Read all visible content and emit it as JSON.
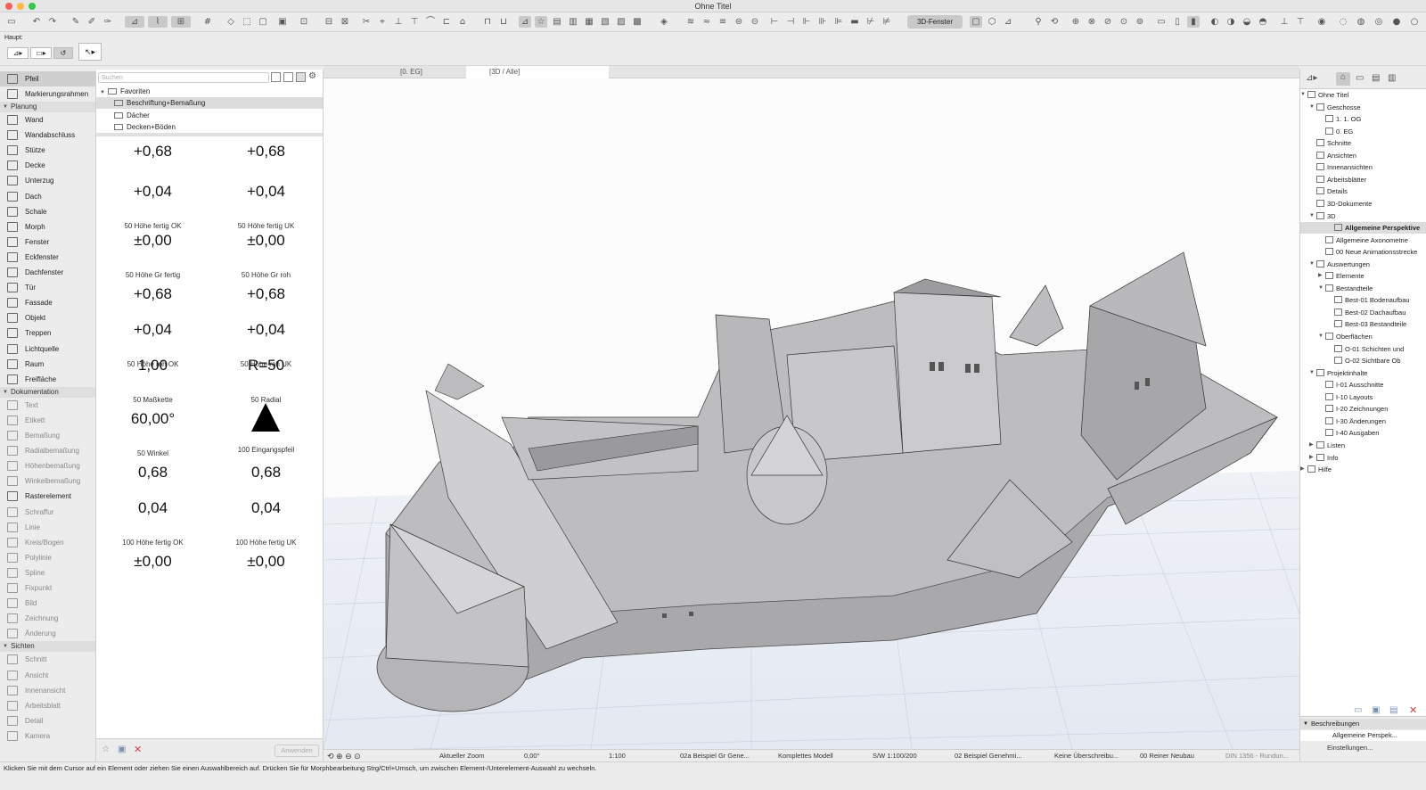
{
  "window": {
    "title": "Ohne Titel"
  },
  "toolbar": {
    "window_3d_label": "3D-Fenster"
  },
  "infobox": {
    "label": "Haupt:"
  },
  "toolbox": {
    "items": [
      {
        "label": "Pfeil",
        "active": true
      },
      {
        "label": "Markierungsrahmen"
      }
    ],
    "planung_label": "Planung",
    "planung": [
      "Wand",
      "Wandabschluss",
      "Stütze",
      "Decke",
      "Unterzug",
      "Dach",
      "Schale",
      "Morph",
      "Fenster",
      "Eckfenster",
      "Dachfenster",
      "Tür",
      "Fassade",
      "Objekt",
      "Treppen",
      "Lichtquelle",
      "Raum",
      "Freifläche"
    ],
    "doku_label": "Dokumentation",
    "doku": [
      "Text",
      "Etikett",
      "Bemaßung",
      "Radialbemaßung",
      "Höhenbemaßung",
      "Winkelbemaßung",
      "Rasterelement",
      "Schraffur",
      "Linie",
      "Kreis/Bogen",
      "Polylinie",
      "Spline",
      "Fixpunkt",
      "Bild",
      "Zeichnung",
      "Änderung"
    ],
    "sichten_label": "Sichten",
    "sichten": [
      "Schnitt",
      "Ansicht",
      "Innenansicht",
      "Arbeitsblatt",
      "Detail",
      "Kamera"
    ]
  },
  "favorites": {
    "search_placeholder": "Suchen",
    "root": "Favoriten",
    "folders": [
      "Beschriftung+Bemaßung",
      "Dächer",
      "Decken+Böden"
    ],
    "cells": [
      {
        "big": "+0,68",
        "cap": ""
      },
      {
        "big": "+0,68",
        "cap": ""
      },
      {
        "big": "+0,04",
        "cap": "50 Höhe fertig OK"
      },
      {
        "big": "+0,04",
        "cap": "50 Höhe fertig UK"
      },
      {
        "big": "±0,00",
        "cap": "50 Höhe Gr fertig"
      },
      {
        "big": "±0,00",
        "cap": "50 Höhe Gr roh"
      },
      {
        "big": "+0,68",
        "cap": ""
      },
      {
        "big": "+0,68",
        "cap": ""
      },
      {
        "big": "+0,04",
        "cap": "50 Höhe roh OK"
      },
      {
        "big": "+0,04",
        "cap": "50 Höhe roh UK"
      },
      {
        "big": "1,00",
        "cap": "50 Maßkette"
      },
      {
        "big": "R=50",
        "cap": "50 Radial"
      },
      {
        "big": "60,00°",
        "cap": "50 Winkel"
      },
      {
        "big": "",
        "cap": "100 Eingangspfeil"
      },
      {
        "big": "0,68",
        "cap": ""
      },
      {
        "big": "0,68",
        "cap": ""
      },
      {
        "big": "0,04",
        "cap": "100 Höhe fertig OK"
      },
      {
        "big": "0,04",
        "cap": "100 Höhe fertig UK"
      },
      {
        "big": "±0,00",
        "cap": ""
      },
      {
        "big": "±0,00",
        "cap": ""
      }
    ],
    "apply_label": "Anwenden"
  },
  "tabs": [
    {
      "label": "[0. EG]"
    },
    {
      "label": "[3D / Alle]",
      "active": true
    }
  ],
  "navigator": {
    "items": [
      {
        "label": "Ohne Titel",
        "level": 0,
        "tri": "▼"
      },
      {
        "label": "Geschosse",
        "level": 1,
        "tri": "▼"
      },
      {
        "label": "1. 1. OG",
        "level": 2
      },
      {
        "label": "0. EG",
        "level": 2
      },
      {
        "label": "Schnitte",
        "level": 1
      },
      {
        "label": "Ansichten",
        "level": 1
      },
      {
        "label": "Innenansichten",
        "level": 1
      },
      {
        "label": "Arbeitsblätter",
        "level": 1
      },
      {
        "label": "Details",
        "level": 1
      },
      {
        "label": "3D-Dokumente",
        "level": 1
      },
      {
        "label": "3D",
        "level": 1,
        "tri": "▼"
      },
      {
        "label": "Allgemeine Perspektive",
        "level": 2,
        "selected": true
      },
      {
        "label": "Allgemeine Axonometrie",
        "level": 2
      },
      {
        "label": "00 Neue Animationsstrecke",
        "level": 2
      },
      {
        "label": "Auswertungen",
        "level": 1,
        "tri": "▼"
      },
      {
        "label": "Elemente",
        "level": 2,
        "tri": "▶"
      },
      {
        "label": "Bestandteile",
        "level": 2,
        "tri": "▼"
      },
      {
        "label": "Best-01 Bodenaufbau",
        "level": 3
      },
      {
        "label": "Best-02 Dachaufbau",
        "level": 3
      },
      {
        "label": "Best-03 Bestandteile",
        "level": 3
      },
      {
        "label": "Oberflächen",
        "level": 2,
        "tri": "▼"
      },
      {
        "label": "O-01 Schichten und",
        "level": 3
      },
      {
        "label": "O-02 Sichtbare Ob",
        "level": 3
      },
      {
        "label": "Projektinhalte",
        "level": 1,
        "tri": "▼"
      },
      {
        "label": "I-01 Ausschnitte",
        "level": 2
      },
      {
        "label": "I-10 Layouts",
        "level": 2
      },
      {
        "label": "I-20 Zeichnungen",
        "level": 2
      },
      {
        "label": "I-30 Änderungen",
        "level": 2
      },
      {
        "label": "I-40 Ausgaben",
        "level": 2
      },
      {
        "label": "Listen",
        "level": 1,
        "tri": "▶"
      },
      {
        "label": "Info",
        "level": 1,
        "tri": "▶"
      },
      {
        "label": "Hilfe",
        "level": 0,
        "tri": "▶"
      }
    ],
    "desc_header": "Beschreibungen",
    "desc_item": "Allgemeine Perspek...",
    "settings": "Einstellungen..."
  },
  "viewstatus": {
    "zoom": "Aktueller Zoom",
    "angle": "0,00°",
    "scale": "1:100",
    "layer": "02a Beispiel Gr Gene...",
    "model": "Komplettes Modell",
    "pen": "S/W 1:100/200",
    "combo": "02 Beispiel Genehmi...",
    "override": "Keine Überschreibu...",
    "reno": "00 Reiner Neubau",
    "dim": "DIN 1356 - Rundun..."
  },
  "hint": "Klicken Sie mit dem Cursor auf ein Element oder ziehen Sie einen Auswahlbereich auf. Drücken Sie für Morphbearbeitung Strg/Ctrl+Umsch, um zwischen Element-/Unterelement-Auswahl zu wechseln."
}
